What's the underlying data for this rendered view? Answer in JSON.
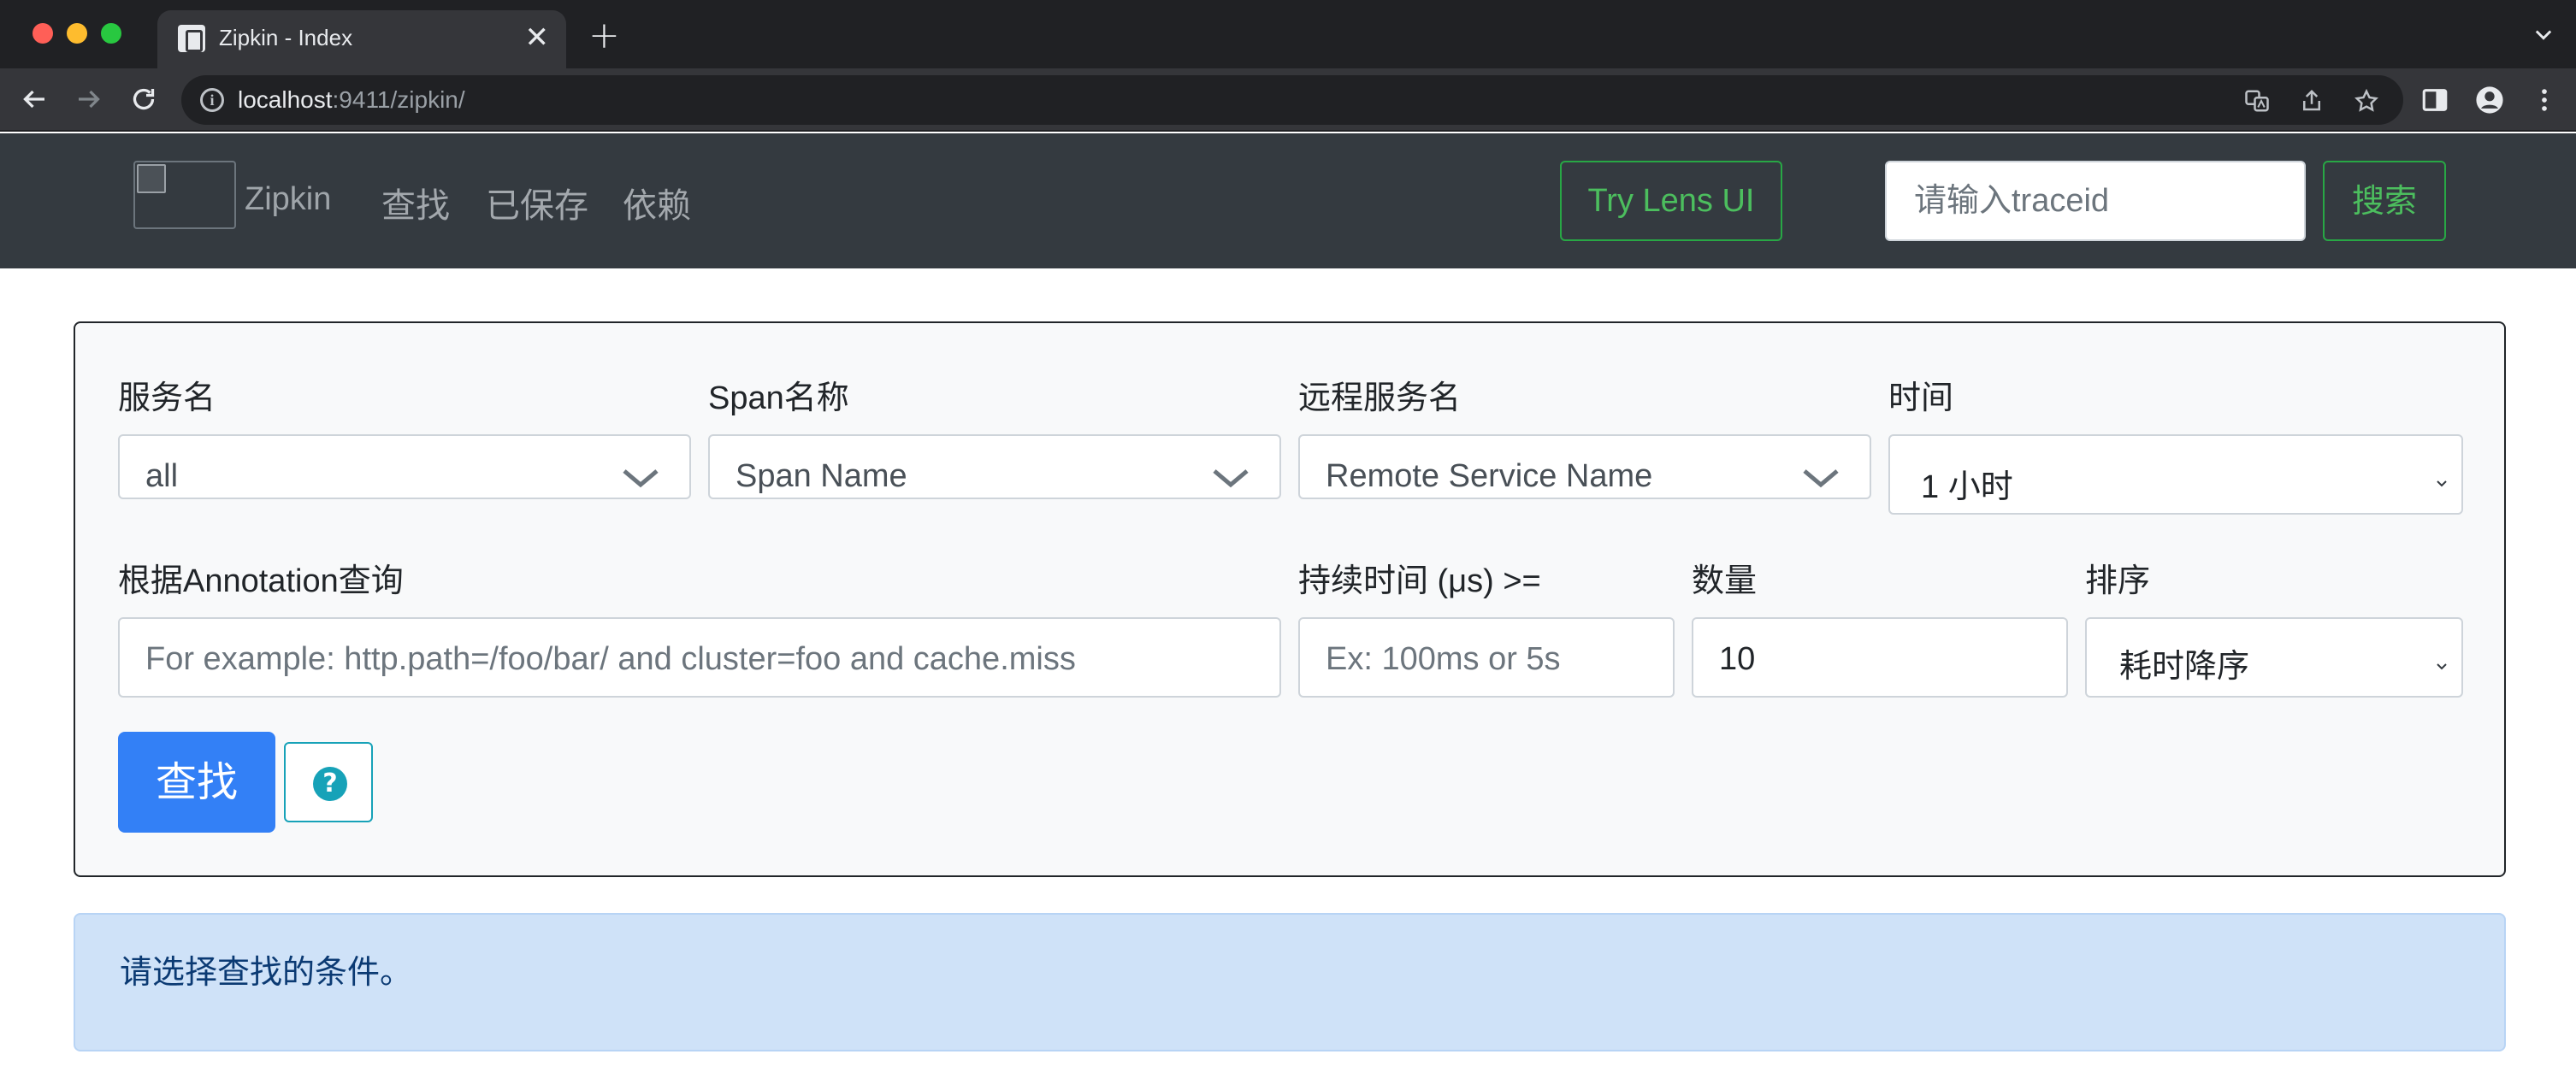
{
  "browser": {
    "tab_title": "Zipkin - Index",
    "tab_close": "✕",
    "new_tab": "+",
    "url_host": "localhost",
    "url_rest": ":9411/zipkin/"
  },
  "navbar": {
    "brand": "Zipkin",
    "links": [
      "查找",
      "已保存",
      "依赖"
    ],
    "lens_button": "Try Lens UI",
    "traceid_placeholder": "请输入traceid",
    "search_button": "搜索"
  },
  "search_form": {
    "service_label": "服务名",
    "service_value": "all",
    "span_label": "Span名称",
    "span_placeholder": "Span Name",
    "remote_label": "远程服务名",
    "remote_placeholder": "Remote Service Name",
    "time_label": "时间",
    "time_value": "1 小时",
    "annotation_label": "根据Annotation查询",
    "annotation_placeholder": "For example: http.path=/foo/bar/ and cluster=foo and cache.miss",
    "duration_label": "持续时间 (μs) >=",
    "duration_placeholder": "Ex: 100ms or 5s",
    "limit_label": "数量",
    "limit_value": "10",
    "sort_label": "排序",
    "sort_value": "耗时降序",
    "find_button": "查找",
    "help_icon": "question-circle-icon"
  },
  "alert": {
    "message": "请选择查找的条件。"
  }
}
